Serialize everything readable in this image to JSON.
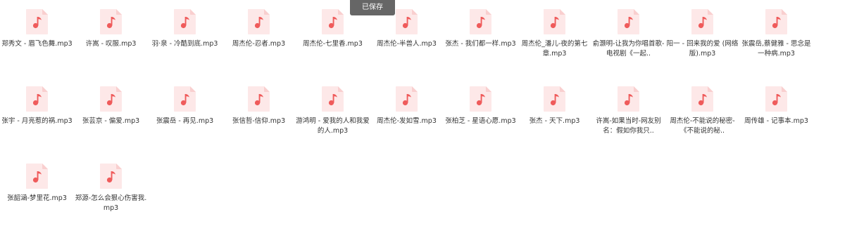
{
  "toast": {
    "text": "已保存"
  },
  "colors": {
    "icon_bg": "#fde8e8",
    "icon_fold": "#f9cfcf",
    "note": "#ef5b5b"
  },
  "files": [
    {
      "name": "郑秀文 - 眉飞色舞.mp3",
      "icon": "music-note-icon"
    },
    {
      "name": "许嵩 - 叹服.mp3",
      "icon": "music-note-icon"
    },
    {
      "name": "羽·泉 - 冷酷到底.mp3",
      "icon": "music-note-icon"
    },
    {
      "name": "周杰伦-忍者.mp3",
      "icon": "music-note-icon"
    },
    {
      "name": "周杰伦-七里香.mp3",
      "icon": "music-note-icon"
    },
    {
      "name": "周杰伦-半兽人.mp3",
      "icon": "music-note-icon"
    },
    {
      "name": "张杰 - 我们都一样.mp3",
      "icon": "music-note-icon"
    },
    {
      "name": "周杰伦_潘儿-夜的第七章.mp3",
      "icon": "music-note-icon"
    },
    {
      "name": "俞灏明-让我为你唱首歌-电视剧《一起..",
      "icon": "music-note-icon"
    },
    {
      "name": "阳一 - 回来我的爱 (网络版).mp3",
      "icon": "music-note-icon"
    },
    {
      "name": "张震岳,蔡健雅 - 思念是一种病.mp3",
      "icon": "music-note-icon"
    },
    {
      "name": "张宇 - 月亮惹的祸.mp3",
      "icon": "music-note-icon"
    },
    {
      "name": "张芸京 - 偏爱.mp3",
      "icon": "music-note-icon"
    },
    {
      "name": "张震岳 - 再见.mp3",
      "icon": "music-note-icon"
    },
    {
      "name": "张信哲-信仰.mp3",
      "icon": "music-note-icon"
    },
    {
      "name": "游鸿明 - 爱我的人和我爱的人.mp3",
      "icon": "music-note-icon"
    },
    {
      "name": "周杰伦-发如雪.mp3",
      "icon": "music-note-icon"
    },
    {
      "name": "张柏芝 - 星语心愿.mp3",
      "icon": "music-note-icon"
    },
    {
      "name": "张杰 - 天下.mp3",
      "icon": "music-note-icon"
    },
    {
      "name": "许嵩-如果当时-网友别名：假如你我只..",
      "icon": "music-note-icon"
    },
    {
      "name": "周杰伦-不能说的秘密-《不能说的秘..",
      "icon": "music-note-icon"
    },
    {
      "name": "周传雄 - 记事本.mp3",
      "icon": "music-note-icon"
    },
    {
      "name": "张韶涵-梦里花.mp3",
      "icon": "music-note-icon"
    },
    {
      "name": "郑源-怎么会狠心伤害我.mp3",
      "icon": "music-note-icon"
    }
  ]
}
